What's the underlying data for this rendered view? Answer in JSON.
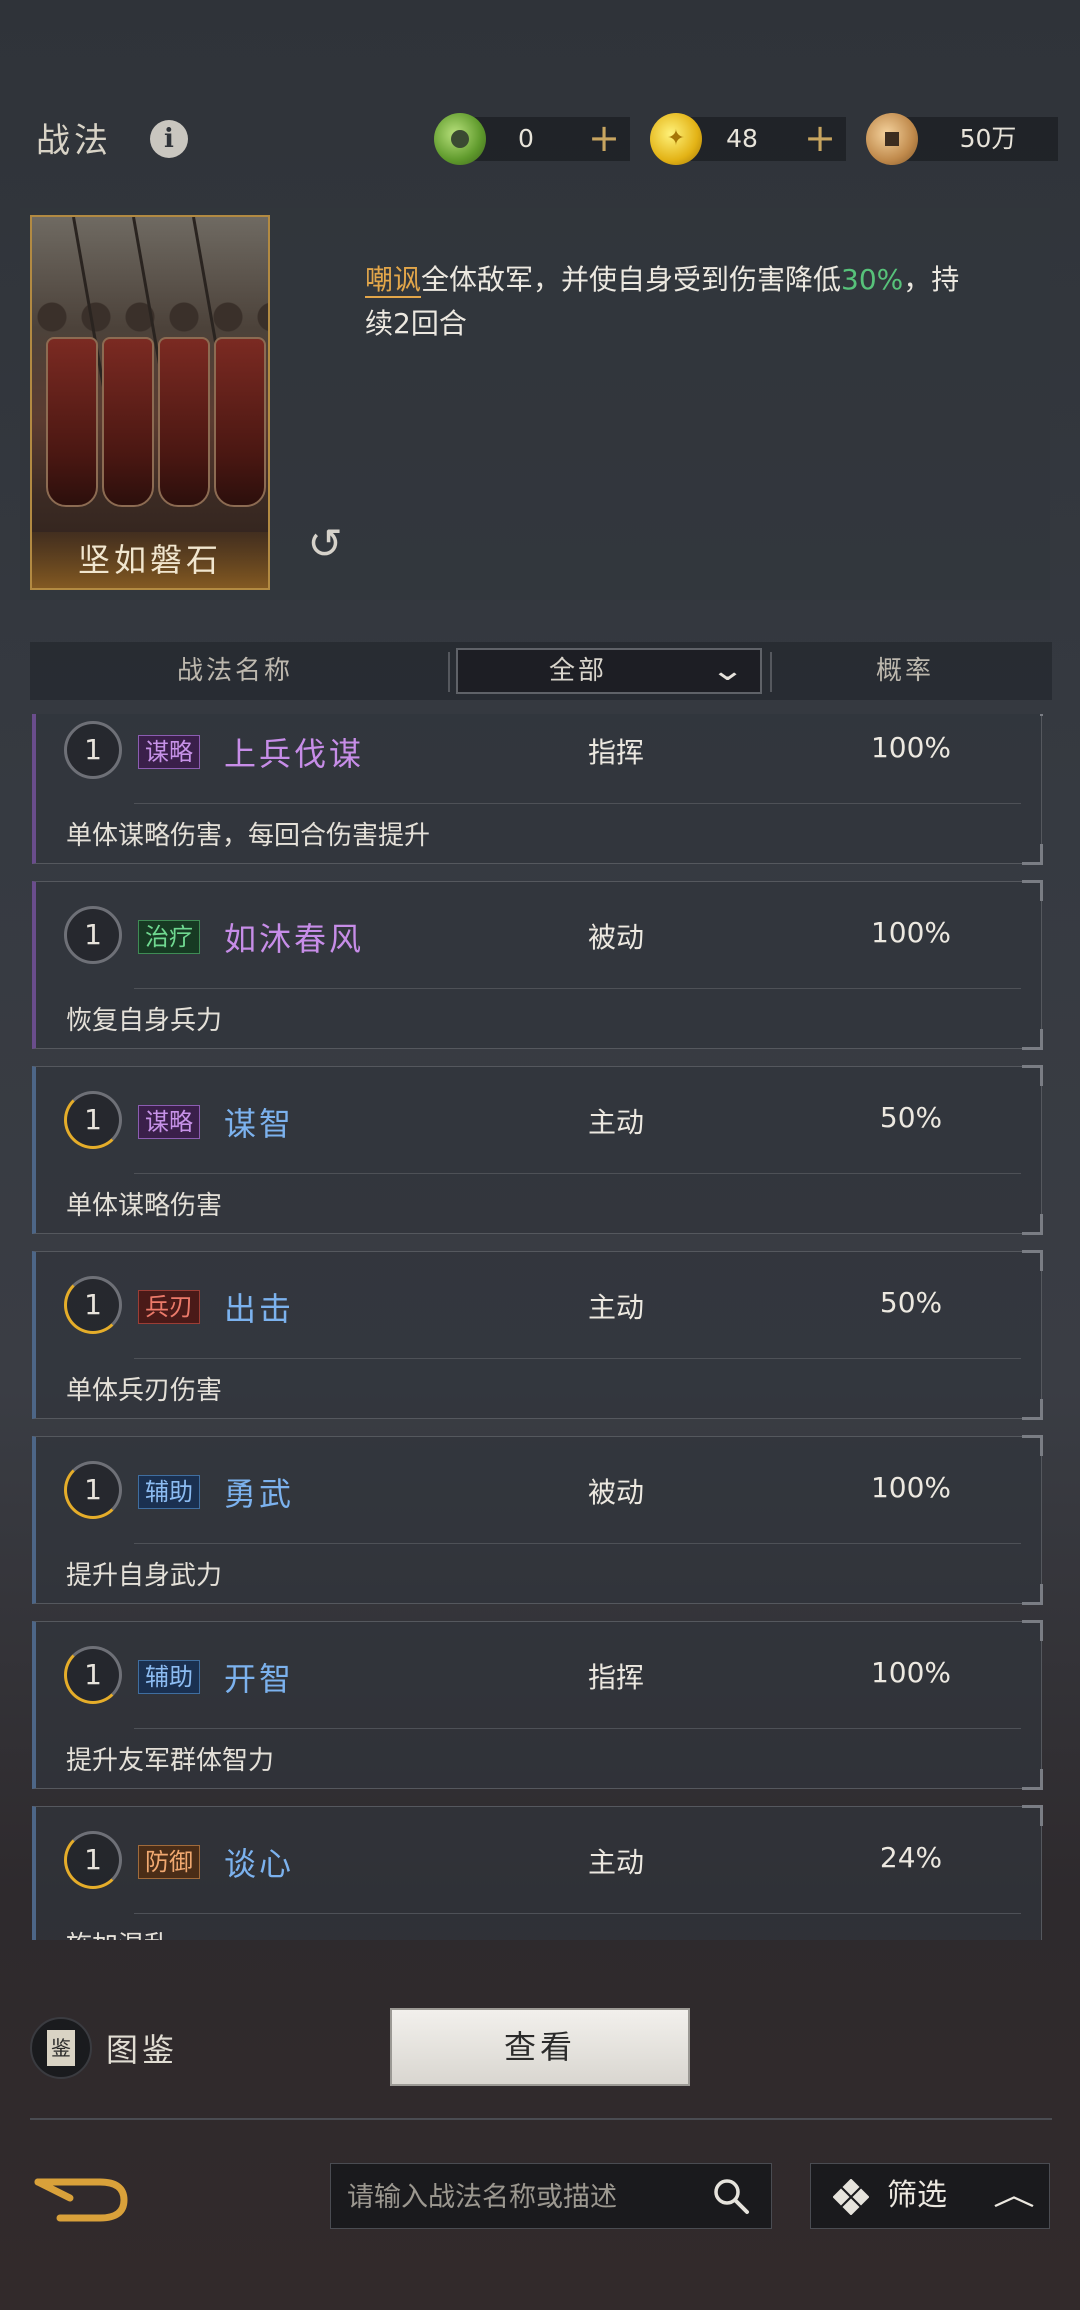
{
  "header": {
    "title": "战法",
    "currencies": [
      {
        "icon": "jade-coin-icon",
        "value": "0",
        "plus": "+"
      },
      {
        "icon": "gold-coin-icon",
        "value": "48",
        "plus": "+"
      },
      {
        "icon": "copper-coin-icon",
        "value": "50万"
      }
    ]
  },
  "detail": {
    "card_name": "坚如磐石",
    "desc_keyword": "嘲讽",
    "desc_part1": "全体敌军，并使自身受到伤害降低",
    "desc_number": "30%",
    "desc_part2": "，持续2回合"
  },
  "filter": {
    "col_name": "战法名称",
    "dropdown_value": "全部",
    "col_prob": "概率"
  },
  "skills": [
    {
      "level": "1",
      "tag": "谋略",
      "name": "上兵伐谋",
      "type": "指挥",
      "prob": "100%",
      "desc": "单体谋略伤害，每回合伤害提升"
    },
    {
      "level": "1",
      "tag": "治疗",
      "name": "如沐春风",
      "type": "被动",
      "prob": "100%",
      "desc": "恢复自身兵力"
    },
    {
      "level": "1",
      "tag": "谋略",
      "name": "谋智",
      "type": "主动",
      "prob": "50%",
      "desc": "单体谋略伤害"
    },
    {
      "level": "1",
      "tag": "兵刃",
      "name": "出击",
      "type": "主动",
      "prob": "50%",
      "desc": "单体兵刃伤害"
    },
    {
      "level": "1",
      "tag": "辅助",
      "name": "勇武",
      "type": "被动",
      "prob": "100%",
      "desc": "提升自身武力"
    },
    {
      "level": "1",
      "tag": "辅助",
      "name": "开智",
      "type": "指挥",
      "prob": "100%",
      "desc": "提升友军群体智力"
    },
    {
      "level": "1",
      "tag": "防御",
      "name": "谈心",
      "type": "主动",
      "prob": "24%",
      "desc": "施加混乱"
    }
  ],
  "bottom": {
    "book_label": "图鉴",
    "view_button": "查看",
    "search_placeholder": "请输入战法名称或描述",
    "filter_label": "筛选"
  }
}
